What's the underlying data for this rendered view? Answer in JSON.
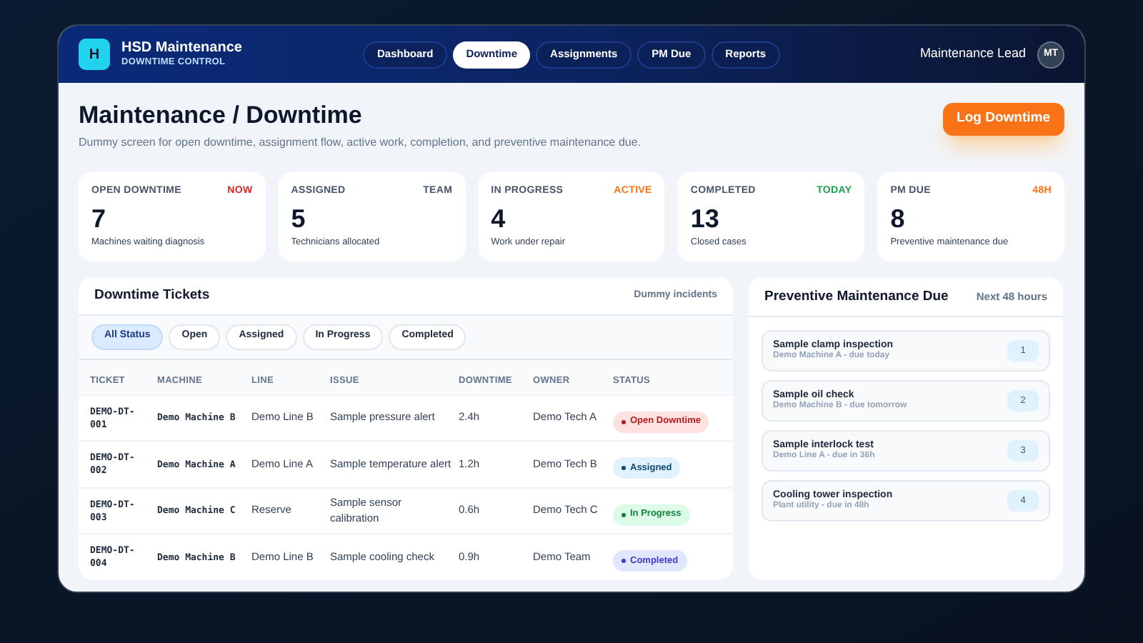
{
  "app": {
    "logo": "H",
    "name": "HSD Maintenance",
    "subtitle": "DOWNTIME CONTROL"
  },
  "nav": [
    {
      "label": "Dashboard",
      "selected": false
    },
    {
      "label": "Downtime",
      "selected": true
    },
    {
      "label": "Assignments",
      "selected": false
    },
    {
      "label": "PM Due",
      "selected": false
    },
    {
      "label": "Reports",
      "selected": false
    }
  ],
  "user": {
    "role": "Maintenance Lead",
    "initials": "MT"
  },
  "page": {
    "title": "Maintenance / Downtime",
    "description": "Dummy screen for open downtime, assignment flow, active work, completion, and preventive maintenance due.",
    "action": "Log Downtime"
  },
  "stats": [
    {
      "label": "OPEN DOWNTIME",
      "tag": "NOW",
      "color": "#dc2626",
      "value": "7",
      "note": "Machines waiting diagnosis"
    },
    {
      "label": "ASSIGNED",
      "tag": "TEAM",
      "color": "#475569",
      "value": "5",
      "note": "Technicians allocated"
    },
    {
      "label": "IN PROGRESS",
      "tag": "ACTIVE",
      "color": "#f97316",
      "value": "4",
      "note": "Work under repair"
    },
    {
      "label": "COMPLETED",
      "tag": "TODAY",
      "color": "#16a34a",
      "value": "13",
      "note": "Closed cases"
    },
    {
      "label": "PM DUE",
      "tag": "48H",
      "color": "#f97316",
      "value": "8",
      "note": "Preventive maintenance due"
    }
  ],
  "tickets": {
    "title": "Downtime Tickets",
    "note": "Dummy incidents",
    "filters": [
      {
        "label": "All Status",
        "selected": true
      },
      {
        "label": "Open",
        "selected": false
      },
      {
        "label": "Assigned",
        "selected": false
      },
      {
        "label": "In Progress",
        "selected": false
      },
      {
        "label": "Completed",
        "selected": false
      }
    ],
    "columns": [
      "TICKET",
      "MACHINE",
      "LINE",
      "ISSUE",
      "DOWNTIME",
      "OWNER",
      "STATUS"
    ],
    "rows": [
      {
        "ticket": "DEMO-DT-001",
        "machine": "Demo Machine B",
        "line": "Demo Line B",
        "issue": "Sample pressure alert",
        "downtime": "2.4h",
        "owner": "Demo Tech A",
        "status": "Open Downtime",
        "kind": "open"
      },
      {
        "ticket": "DEMO-DT-002",
        "machine": "Demo Machine A",
        "line": "Demo Line A",
        "issue": "Sample temperature alert",
        "downtime": "1.2h",
        "owner": "Demo Tech B",
        "status": "Assigned",
        "kind": "assigned"
      },
      {
        "ticket": "DEMO-DT-003",
        "machine": "Demo Machine C",
        "line": "Reserve",
        "issue": "Sample sensor calibration",
        "downtime": "0.6h",
        "owner": "Demo Tech C",
        "status": "In Progress",
        "kind": "progress"
      },
      {
        "ticket": "DEMO-DT-004",
        "machine": "Demo Machine B",
        "line": "Demo Line B",
        "issue": "Sample cooling check",
        "downtime": "0.9h",
        "owner": "Demo Team",
        "status": "Completed",
        "kind": "completed"
      }
    ]
  },
  "pm": {
    "title": "Preventive Maintenance Due",
    "note": "Next 48 hours",
    "items": [
      {
        "title": "Sample clamp inspection",
        "detail": "Demo Machine A - due today",
        "number": "1"
      },
      {
        "title": "Sample oil check",
        "detail": "Demo Machine B - due tomorrow",
        "number": "2"
      },
      {
        "title": "Sample interlock test",
        "detail": "Demo Line A - due in 36h",
        "number": "3"
      },
      {
        "title": "Cooling tower inspection",
        "detail": "Plant utility - due in 48h",
        "number": "4"
      }
    ]
  }
}
